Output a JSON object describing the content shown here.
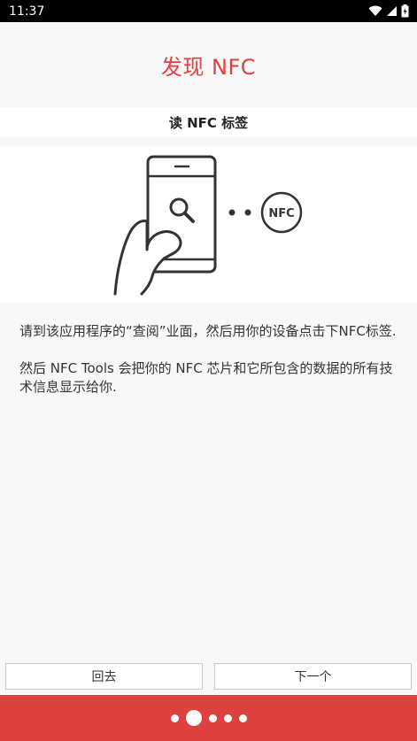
{
  "status_bar": {
    "time": "11:37"
  },
  "header": {
    "title": "发现 NFC"
  },
  "section": {
    "subtitle": "读 NFC 标签"
  },
  "illustration": {
    "badge_text": "NFC"
  },
  "content": {
    "paragraph1": "请到该应用程序的“查阅”业面，然后用你的设备点击下NFC标签.",
    "paragraph2": "然后 NFC Tools 会把你的 NFC 芯片和它所包含的数据的所有技术信息显示给你."
  },
  "buttons": {
    "back_label": "回去",
    "next_label": "下一个"
  },
  "pager": {
    "page_count": 5,
    "current_page": 2
  },
  "colors": {
    "accent": "#e0403f",
    "bottom_bar": "#dd4140"
  }
}
